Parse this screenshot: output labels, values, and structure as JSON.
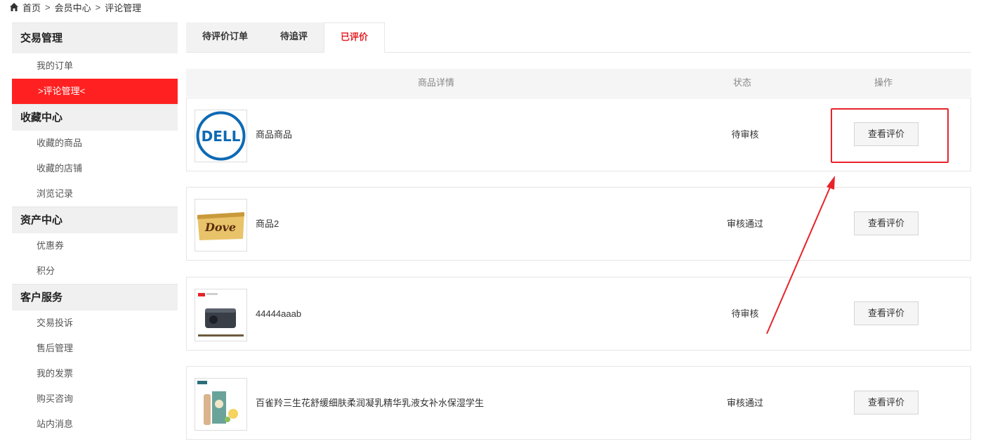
{
  "breadcrumb": {
    "home": "首页",
    "sep": ">",
    "member_center": "会员中心",
    "current": "评论管理"
  },
  "sidebar": {
    "groups": [
      {
        "title": "交易管理",
        "items": [
          "我的订单",
          ">评论管理<"
        ]
      },
      {
        "title": "收藏中心",
        "items": [
          "收藏的商品",
          "收藏的店铺",
          "浏览记录"
        ]
      },
      {
        "title": "资产中心",
        "items": [
          "优惠券",
          "积分"
        ]
      },
      {
        "title": "客户服务",
        "items": [
          "交易投诉",
          "售后管理",
          "我的发票",
          "购买咨询",
          "站内消息"
        ]
      }
    ],
    "active_item": ">评论管理<"
  },
  "tabs": [
    {
      "label": "待评价订单",
      "active": false
    },
    {
      "label": "待追评",
      "active": false
    },
    {
      "label": "已评价",
      "active": true
    }
  ],
  "table": {
    "headers": {
      "detail": "商品详情",
      "status": "状态",
      "operation": "操作"
    },
    "rows": [
      {
        "name": "商品商品",
        "status": "待审核",
        "action": "查看评价",
        "image": "dell-logo"
      },
      {
        "name": "商品2",
        "status": "审核通过",
        "action": "查看评价",
        "image": "dove-chocolate"
      },
      {
        "name": "44444aaab",
        "status": "待审核",
        "action": "查看评价",
        "image": "projector"
      },
      {
        "name": "百雀羚三生花舒缓细肤柔润凝乳精华乳液女补水保湿学生",
        "status": "审核通过",
        "action": "查看评价",
        "image": "skincare-set"
      }
    ]
  },
  "colors": {
    "accent": "#e4242a",
    "sidebar_active_bg": "#ff2121",
    "annotation": "#e8232a"
  },
  "icons": {
    "home": "home-icon"
  }
}
